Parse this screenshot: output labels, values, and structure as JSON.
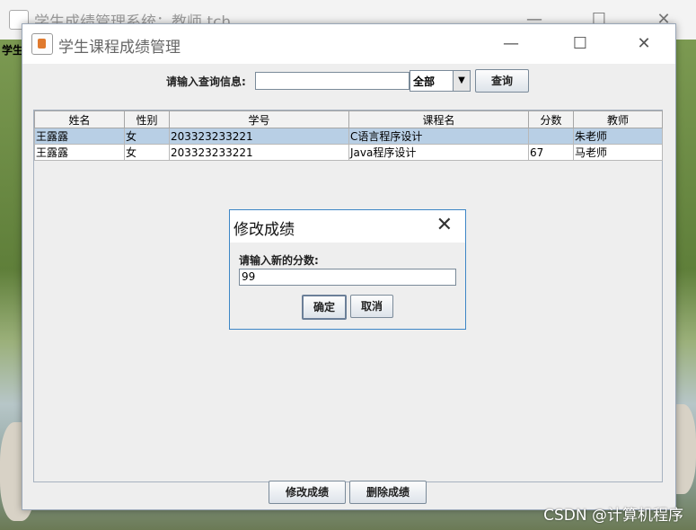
{
  "back_window": {
    "title": "学生成绩管理系统：教师 tch",
    "controls": [
      "—",
      "☐",
      "✕"
    ],
    "left_label": "学生"
  },
  "window": {
    "title": "学生课程成绩管理",
    "controls": {
      "minimize": "—",
      "maximize": "☐",
      "close": "✕"
    }
  },
  "query": {
    "label": "请输入查询信息:",
    "input_value": "",
    "select_value": "全部",
    "button": "查询"
  },
  "table": {
    "columns": [
      "姓名",
      "性别",
      "学号",
      "课程名",
      "分数",
      "教师"
    ],
    "rows": [
      [
        "王露露",
        "女",
        "203323233221",
        "C语言程序设计",
        "",
        "朱老师"
      ],
      [
        "王露露",
        "女",
        "203323233221",
        "Java程序设计",
        "67",
        "马老师"
      ]
    ],
    "selected_row": 0
  },
  "actions": {
    "modify": "修改成绩",
    "delete": "删除成绩"
  },
  "dialog": {
    "title": "修改成绩",
    "close": "✕",
    "label": "请输入新的分数:",
    "value": "99",
    "ok": "确定",
    "cancel": "取消"
  },
  "watermark": "CSDN @计算机程序",
  "colors": {
    "selected_row": "#b8cfe5",
    "dialog_border": "#3d86c6"
  }
}
